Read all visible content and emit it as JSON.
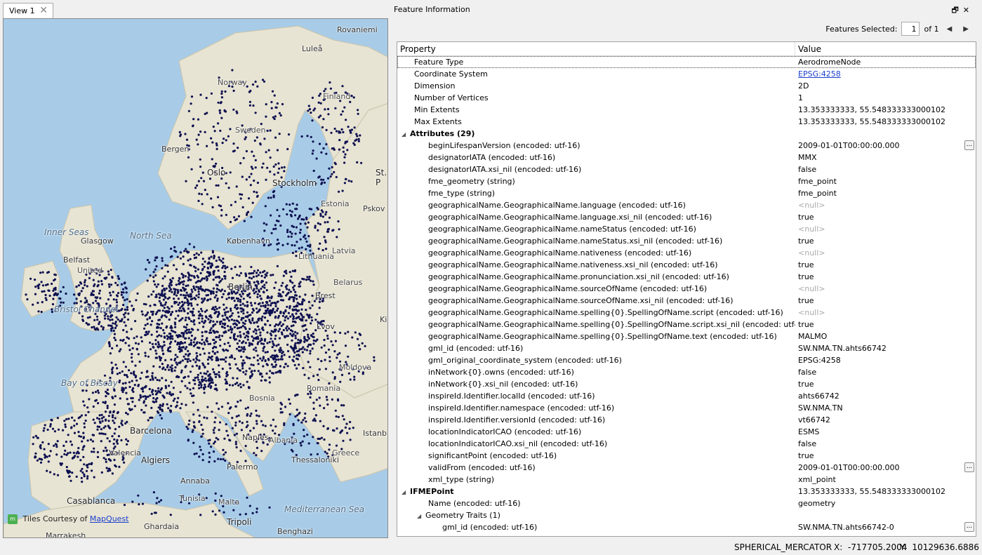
{
  "view_tab": {
    "label": "View 1",
    "close": "✕"
  },
  "map": {
    "attribution_prefix": "Tiles Courtesy of",
    "attribution_link": "MapQuest",
    "labels": [
      {
        "text": "Rovaniemi",
        "cls": "city"
      },
      {
        "text": "Luleå",
        "cls": "city"
      },
      {
        "text": "Norway",
        "cls": ""
      },
      {
        "text": "Finland",
        "cls": ""
      },
      {
        "text": "Sweden",
        "cls": ""
      },
      {
        "text": "Bergen",
        "cls": "city"
      },
      {
        "text": "Oslo",
        "cls": "bigcity"
      },
      {
        "text": "Stockholm",
        "cls": "bigcity"
      },
      {
        "text": "St. P",
        "cls": "bigcity"
      },
      {
        "text": "Estonia",
        "cls": ""
      },
      {
        "text": "Pskov",
        "cls": "city"
      },
      {
        "text": "Latvia",
        "cls": ""
      },
      {
        "text": "Inner Seas",
        "cls": "sea"
      },
      {
        "text": "Glasgow",
        "cls": "city"
      },
      {
        "text": "North Sea",
        "cls": "sea"
      },
      {
        "text": "København",
        "cls": "city"
      },
      {
        "text": "Belfast",
        "cls": "city"
      },
      {
        "text": "United",
        "cls": ""
      },
      {
        "text": "Lithuania",
        "cls": ""
      },
      {
        "text": "Berlin",
        "cls": "bigcity"
      },
      {
        "text": "Belarus",
        "cls": ""
      },
      {
        "text": "Bristol Channel",
        "cls": "sea"
      },
      {
        "text": "Brest",
        "cls": "city"
      },
      {
        "text": "Lvov",
        "cls": "city"
      },
      {
        "text": "Kie",
        "cls": "city"
      },
      {
        "text": "Moldova",
        "cls": ""
      },
      {
        "text": "Bay of Biscay",
        "cls": "sea"
      },
      {
        "text": "Romania",
        "cls": ""
      },
      {
        "text": "Bosnia",
        "cls": ""
      },
      {
        "text": "Barcelona",
        "cls": "bigcity"
      },
      {
        "text": "Valencia",
        "cls": "city"
      },
      {
        "text": "Naples",
        "cls": "city"
      },
      {
        "text": "Albania",
        "cls": ""
      },
      {
        "text": "Thessaloniki",
        "cls": "city"
      },
      {
        "text": "Istanb",
        "cls": "city"
      },
      {
        "text": "Palermo",
        "cls": "city"
      },
      {
        "text": "Greece",
        "cls": ""
      },
      {
        "text": "Algiers",
        "cls": "bigcity"
      },
      {
        "text": "Annaba",
        "cls": "city"
      },
      {
        "text": "Malta",
        "cls": ""
      },
      {
        "text": "Casablanca",
        "cls": "bigcity"
      },
      {
        "text": "Tunisia",
        "cls": ""
      },
      {
        "text": "Tripoli",
        "cls": "bigcity"
      },
      {
        "text": "Mediterranean Sea",
        "cls": "sea"
      },
      {
        "text": "Ghardaia",
        "cls": "city"
      },
      {
        "text": "Marrakesh",
        "cls": "city"
      },
      {
        "text": "Benghazi",
        "cls": "city"
      }
    ]
  },
  "panel": {
    "title": "Feature Information",
    "float_icon": "🗗",
    "close_icon": "✕",
    "features_selected_label": "Features Selected:",
    "features_selected_value": "1",
    "features_total": "of 1",
    "prev_icon": "◀",
    "next_icon": "▶"
  },
  "table": {
    "header_property": "Property",
    "header_value": "Value",
    "rows": [
      {
        "indent": 1,
        "prop": "Feature Type",
        "value": "AerodromeNode",
        "selected": true
      },
      {
        "indent": 1,
        "prop": "Coordinate System",
        "value": "EPSG:4258",
        "link": true
      },
      {
        "indent": 1,
        "prop": "Dimension",
        "value": "2D"
      },
      {
        "indent": 1,
        "prop": "Number of Vertices",
        "value": "1"
      },
      {
        "indent": 1,
        "prop": "Min Extents",
        "value": "13.353333333, 55.548333333000102"
      },
      {
        "indent": 1,
        "prop": "Max Extents",
        "value": "13.353333333, 55.548333333000102"
      },
      {
        "indent": 0,
        "prop": "Attributes (29)",
        "value": "",
        "bold": true,
        "expander": "◢"
      },
      {
        "indent": 2,
        "prop": "beginLifespanVersion (encoded: utf-16)",
        "value": "2009-01-01T00:00:00.000",
        "ellipsis": true
      },
      {
        "indent": 2,
        "prop": "designatorIATA (encoded: utf-16)",
        "value": "MMX"
      },
      {
        "indent": 2,
        "prop": "designatorIATA.xsi_nil (encoded: utf-16)",
        "value": "false"
      },
      {
        "indent": 2,
        "prop": "fme_geometry (string)",
        "value": "fme_point"
      },
      {
        "indent": 2,
        "prop": "fme_type (string)",
        "value": "fme_point"
      },
      {
        "indent": 2,
        "prop": "geographicalName.GeographicalName.language (encoded: utf-16)",
        "value": "<null>",
        "null": true
      },
      {
        "indent": 2,
        "prop": "geographicalName.GeographicalName.language.xsi_nil (encoded: utf-16)",
        "value": "true"
      },
      {
        "indent": 2,
        "prop": "geographicalName.GeographicalName.nameStatus (encoded: utf-16)",
        "value": "<null>",
        "null": true
      },
      {
        "indent": 2,
        "prop": "geographicalName.GeographicalName.nameStatus.xsi_nil (encoded: utf-16)",
        "value": "true"
      },
      {
        "indent": 2,
        "prop": "geographicalName.GeographicalName.nativeness (encoded: utf-16)",
        "value": "<null>",
        "null": true
      },
      {
        "indent": 2,
        "prop": "geographicalName.GeographicalName.nativeness.xsi_nil (encoded: utf-16)",
        "value": "true"
      },
      {
        "indent": 2,
        "prop": "geographicalName.GeographicalName.pronunciation.xsi_nil (encoded: utf-16)",
        "value": "true"
      },
      {
        "indent": 2,
        "prop": "geographicalName.GeographicalName.sourceOfName (encoded: utf-16)",
        "value": "<null>",
        "null": true
      },
      {
        "indent": 2,
        "prop": "geographicalName.GeographicalName.sourceOfName.xsi_nil (encoded: utf-16)",
        "value": "true"
      },
      {
        "indent": 2,
        "prop": "geographicalName.GeographicalName.spelling{0}.SpellingOfName.script (encoded: utf-16)",
        "value": "<null>",
        "null": true
      },
      {
        "indent": 2,
        "prop": "geographicalName.GeographicalName.spelling{0}.SpellingOfName.script.xsi_nil (encoded: utf-16)",
        "value": "true"
      },
      {
        "indent": 2,
        "prop": "geographicalName.GeographicalName.spelling{0}.SpellingOfName.text (encoded: utf-16)",
        "value": "MALMO"
      },
      {
        "indent": 2,
        "prop": "gml_id (encoded: utf-16)",
        "value": "SW.NMA.TN.ahts66742"
      },
      {
        "indent": 2,
        "prop": "gml_original_coordinate_system (encoded: utf-16)",
        "value": "EPSG:4258"
      },
      {
        "indent": 2,
        "prop": "inNetwork{0}.owns (encoded: utf-16)",
        "value": "false"
      },
      {
        "indent": 2,
        "prop": "inNetwork{0}.xsi_nil (encoded: utf-16)",
        "value": "true"
      },
      {
        "indent": 2,
        "prop": "inspireId.Identifier.localId (encoded: utf-16)",
        "value": "ahts66742"
      },
      {
        "indent": 2,
        "prop": "inspireId.Identifier.namespace (encoded: utf-16)",
        "value": "SW.NMA.TN"
      },
      {
        "indent": 2,
        "prop": "inspireId.Identifier.versionId (encoded: utf-16)",
        "value": "vt66742"
      },
      {
        "indent": 2,
        "prop": "locationIndicatorICAO (encoded: utf-16)",
        "value": "ESMS"
      },
      {
        "indent": 2,
        "prop": "locationIndicatorICAO.xsi_nil (encoded: utf-16)",
        "value": "false"
      },
      {
        "indent": 2,
        "prop": "significantPoint (encoded: utf-16)",
        "value": "true"
      },
      {
        "indent": 2,
        "prop": "validFrom (encoded: utf-16)",
        "value": "2009-01-01T00:00:00.000",
        "ellipsis": true
      },
      {
        "indent": 2,
        "prop": "xml_type (string)",
        "value": "xml_point"
      },
      {
        "indent": 0,
        "prop": "IFMEPoint",
        "value": "13.353333333, 55.548333333000102",
        "bold": true,
        "expander": "◢"
      },
      {
        "indent": 2,
        "prop": "Name (encoded: utf-16)",
        "value": "geometry"
      },
      {
        "indent": 1.5,
        "prop": "Geometry Traits (1)",
        "value": "",
        "expander": "◢"
      },
      {
        "indent": 3,
        "prop": "gml_id (encoded: utf-16)",
        "value": "SW.NMA.TN.ahts66742-0",
        "ellipsis": true
      }
    ],
    "ellipsis_label": "..."
  },
  "status": {
    "projection": "SPHERICAL_MERCATOR",
    "x_label": "X:",
    "x_value": "-717705.2004",
    "y_label": "Y:",
    "y_value": "10129636.6886"
  },
  "colors": {
    "sea": "#a8cce8",
    "land": "#e8e4d3",
    "point": "#0d1050",
    "link": "#1a3fcc"
  }
}
